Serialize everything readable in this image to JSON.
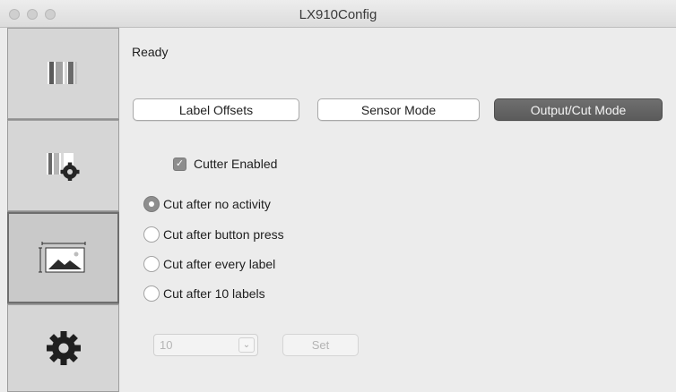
{
  "window": {
    "title": "LX910Config"
  },
  "status": {
    "text": "Ready"
  },
  "tabs": [
    {
      "label": "Label Offsets",
      "selected": false
    },
    {
      "label": "Sensor Mode",
      "selected": false
    },
    {
      "label": "Output/Cut Mode",
      "selected": true
    }
  ],
  "cutter": {
    "checkbox_label": "Cutter Enabled",
    "checked": true
  },
  "radios": [
    {
      "label": "Cut after no activity",
      "selected": true
    },
    {
      "label": "Cut after button press",
      "selected": false
    },
    {
      "label": "Cut after every label",
      "selected": false
    },
    {
      "label": "Cut after 10 labels",
      "selected": false
    }
  ],
  "labels_count": {
    "selected_value": "10",
    "set_label": "Set"
  },
  "sidebar": {
    "items": [
      {
        "icon": "label-roll-icon"
      },
      {
        "icon": "label-settings-icon"
      },
      {
        "icon": "image-print-area-icon"
      },
      {
        "icon": "gear-icon"
      }
    ]
  },
  "colors": {
    "window_bg": "#ececec",
    "selected_tab": "#666666"
  }
}
